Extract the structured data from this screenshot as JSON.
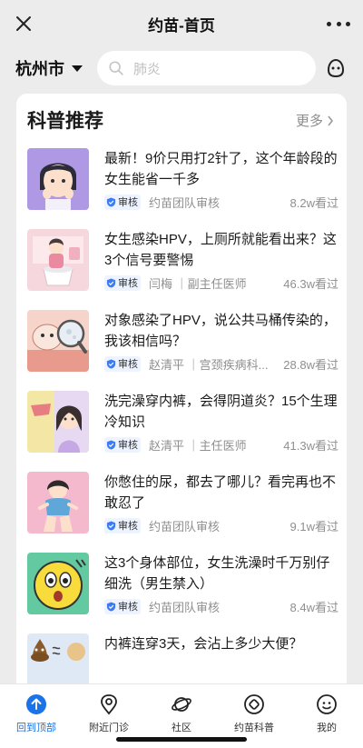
{
  "nav": {
    "title": "约苗-首页"
  },
  "location": {
    "city": "杭州市"
  },
  "search": {
    "placeholder": "肺炎"
  },
  "section": {
    "title": "科普推荐",
    "more_label": "更多"
  },
  "articles": [
    {
      "title": "最新！9价只用打2针了，这个年龄段的女生能省一千多",
      "badge": "审核",
      "author": "约苗团队审核",
      "views": "8.2w看过"
    },
    {
      "title": "女生感染HPV，上厕所就能看出来？这3个信号要警惕",
      "badge": "审核",
      "author": "闫梅 ｜副主任医师",
      "views": "46.3w看过"
    },
    {
      "title": "对象感染了HPV，说公共马桶传染的，我该相信吗？",
      "badge": "审核",
      "author": "赵清平 ｜宫颈疾病科...",
      "views": "28.8w看过"
    },
    {
      "title": "洗完澡穿内裤，会得阴道炎？15个生理冷知识",
      "badge": "审核",
      "author": "赵清平 ｜主任医师",
      "views": "41.3w看过"
    },
    {
      "title": "你憋住的尿，都去了哪儿？看完再也不敢忍了",
      "badge": "审核",
      "author": "约苗团队审核",
      "views": "9.1w看过"
    },
    {
      "title": "这3个身体部位，女生洗澡时千万别仔细洗（男生禁入）",
      "badge": "审核",
      "author": "约苗团队审核",
      "views": "8.4w看过"
    },
    {
      "title": "内裤连穿3天，会沾上多少大便？",
      "badge": "",
      "author": "",
      "views": ""
    }
  ],
  "tabs": [
    {
      "label": "回到顶部",
      "icon": "arrow-up-circle-icon",
      "active": true
    },
    {
      "label": "附近门诊",
      "icon": "location-pin-icon",
      "active": false
    },
    {
      "label": "社区",
      "icon": "planet-icon",
      "active": false
    },
    {
      "label": "约苗科普",
      "icon": "compass-icon",
      "active": false
    },
    {
      "label": "我的",
      "icon": "smiley-face-icon",
      "active": false
    }
  ],
  "colors": {
    "accent": "#1a73e8",
    "background": "#ececec",
    "badge_bg": "#eef4ff"
  }
}
